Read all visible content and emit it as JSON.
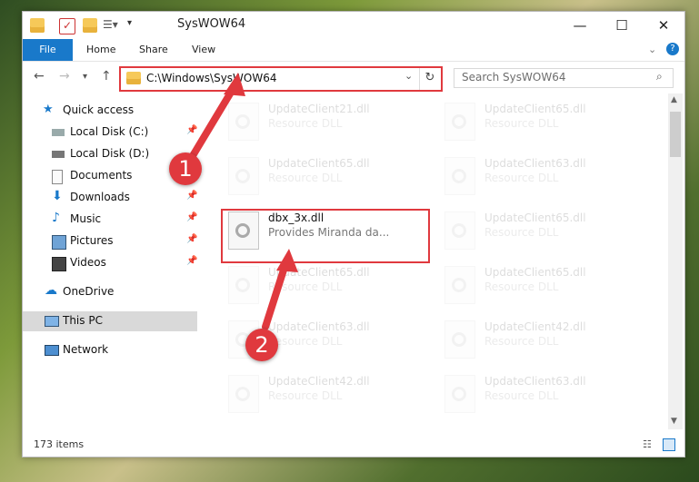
{
  "window": {
    "title": "SysWOW64"
  },
  "ribbon": {
    "tabs": [
      "File",
      "Home",
      "Share",
      "View"
    ]
  },
  "address": {
    "path": "C:\\Windows\\SysWOW64",
    "search_placeholder": "Search SysWOW64"
  },
  "sidebar": {
    "items": [
      {
        "label": "Quick access"
      },
      {
        "label": "Local Disk (C:)"
      },
      {
        "label": "Local Disk (D:)"
      },
      {
        "label": "Documents"
      },
      {
        "label": "Downloads"
      },
      {
        "label": "Music"
      },
      {
        "label": "Pictures"
      },
      {
        "label": "Videos"
      },
      {
        "label": "OneDrive"
      },
      {
        "label": "This PC"
      },
      {
        "label": "Network"
      }
    ]
  },
  "files": [
    {
      "name": "UpdateClient21.dll",
      "desc": "Resource DLL"
    },
    {
      "name": "UpdateClient65.dll",
      "desc": "Resource DLL"
    },
    {
      "name": "UpdateClient65.dll",
      "desc": "Resource DLL"
    },
    {
      "name": "UpdateClient63.dll",
      "desc": "Resource DLL"
    },
    {
      "name": "dbx_3x.dll",
      "desc": "Provides Miranda da..."
    },
    {
      "name": "UpdateClient65.dll",
      "desc": "Resource DLL"
    },
    {
      "name": "UpdateClient65.dll",
      "desc": "Resource DLL"
    },
    {
      "name": "UpdateClient65.dll",
      "desc": "Resource DLL"
    },
    {
      "name": "UpdateClient63.dll",
      "desc": "Resource DLL"
    },
    {
      "name": "UpdateClient42.dll",
      "desc": "Resource DLL"
    },
    {
      "name": "UpdateClient42.dll",
      "desc": "Resource DLL"
    },
    {
      "name": "UpdateClient63.dll",
      "desc": "Resource DLL"
    }
  ],
  "status": {
    "items": "173 items"
  },
  "annotations": {
    "step1": "1",
    "step2": "2"
  }
}
